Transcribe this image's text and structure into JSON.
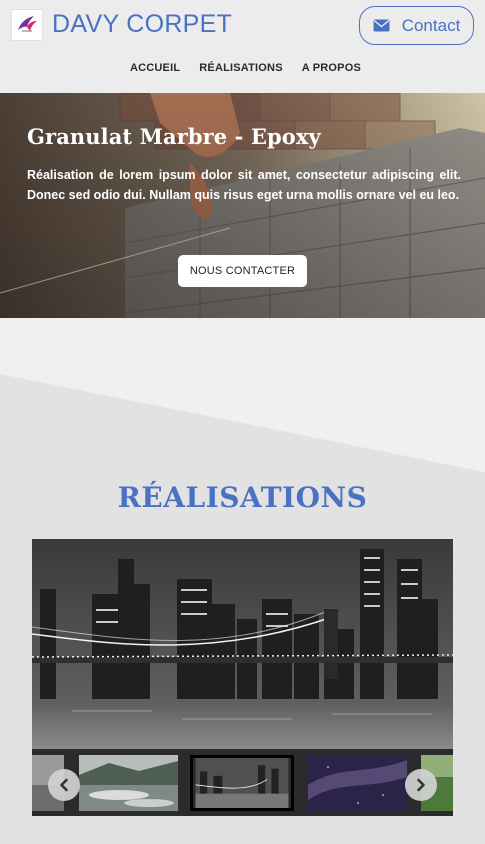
{
  "header": {
    "brand": "DAVY CORPET",
    "contact_label": "Contact",
    "logo_icon": "bird-logo-icon",
    "contact_icon": "envelope-icon"
  },
  "nav": {
    "items": [
      {
        "label": "ACCUEIL"
      },
      {
        "label": "RÉALISATIONS"
      },
      {
        "label": "A PROPOS"
      }
    ]
  },
  "hero": {
    "title": "Granulat Marbre - Epoxy",
    "text": "Réalisation de lorem ipsum dolor sit amet, consectetur adipiscing elit. Donec sed odio dui. Nullam quis risus eget urna mollis ornare vel eu leo.",
    "button_label": "NOUS CONTACTER"
  },
  "realisations": {
    "title": "RÉALISATIONS",
    "prev_icon": "chevron-left-icon",
    "next_icon": "chevron-right-icon",
    "thumbnails": [
      "river-thumbnail",
      "city-bridge-thumbnail",
      "night-sky-thumbnail",
      "green-field-thumbnail"
    ]
  },
  "colors": {
    "accent": "#4a72c2",
    "background": "#ececec",
    "section_light": "#f0f0f0",
    "section_gray": "#e2e2e2"
  }
}
